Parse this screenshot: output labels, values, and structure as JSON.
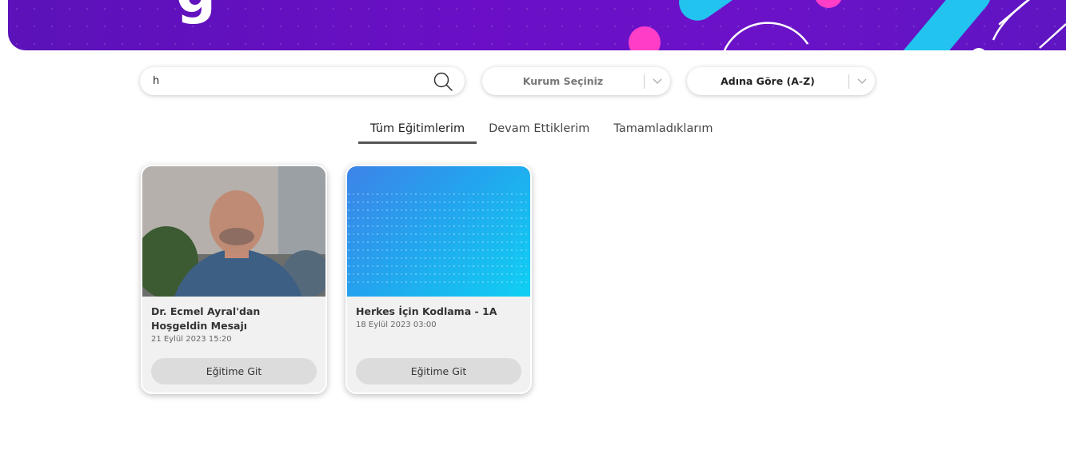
{
  "banner": {
    "letter": "g"
  },
  "search": {
    "value": "h",
    "placeholder": ""
  },
  "filters": {
    "institution": {
      "selected": "Kurum Seçiniz"
    },
    "sort": {
      "selected": "Adına Göre (A-Z)"
    }
  },
  "tabs": [
    {
      "label": "Tüm Eğitimlerim",
      "active": true
    },
    {
      "label": "Devam Ettiklerim",
      "active": false
    },
    {
      "label": "Tamamladıklarım",
      "active": false
    }
  ],
  "courses": [
    {
      "title": "Dr. Ecmel Ayral'dan Hoşgeldin Mesajı",
      "date": "21 Eylül 2023 15:20",
      "button": "Eğitime Git",
      "thumbnail": "person-video"
    },
    {
      "title": "Herkes İçin Kodlama - 1A",
      "date": "18 Eylül 2023 03:00",
      "button": "Eğitime Git",
      "thumbnail": "code-pattern"
    }
  ],
  "colors": {
    "banner": "#6a0fc6",
    "accent_pink": "#ff3ec8",
    "accent_cyan": "#22c3ee",
    "button_bg": "#dcdcdc"
  }
}
